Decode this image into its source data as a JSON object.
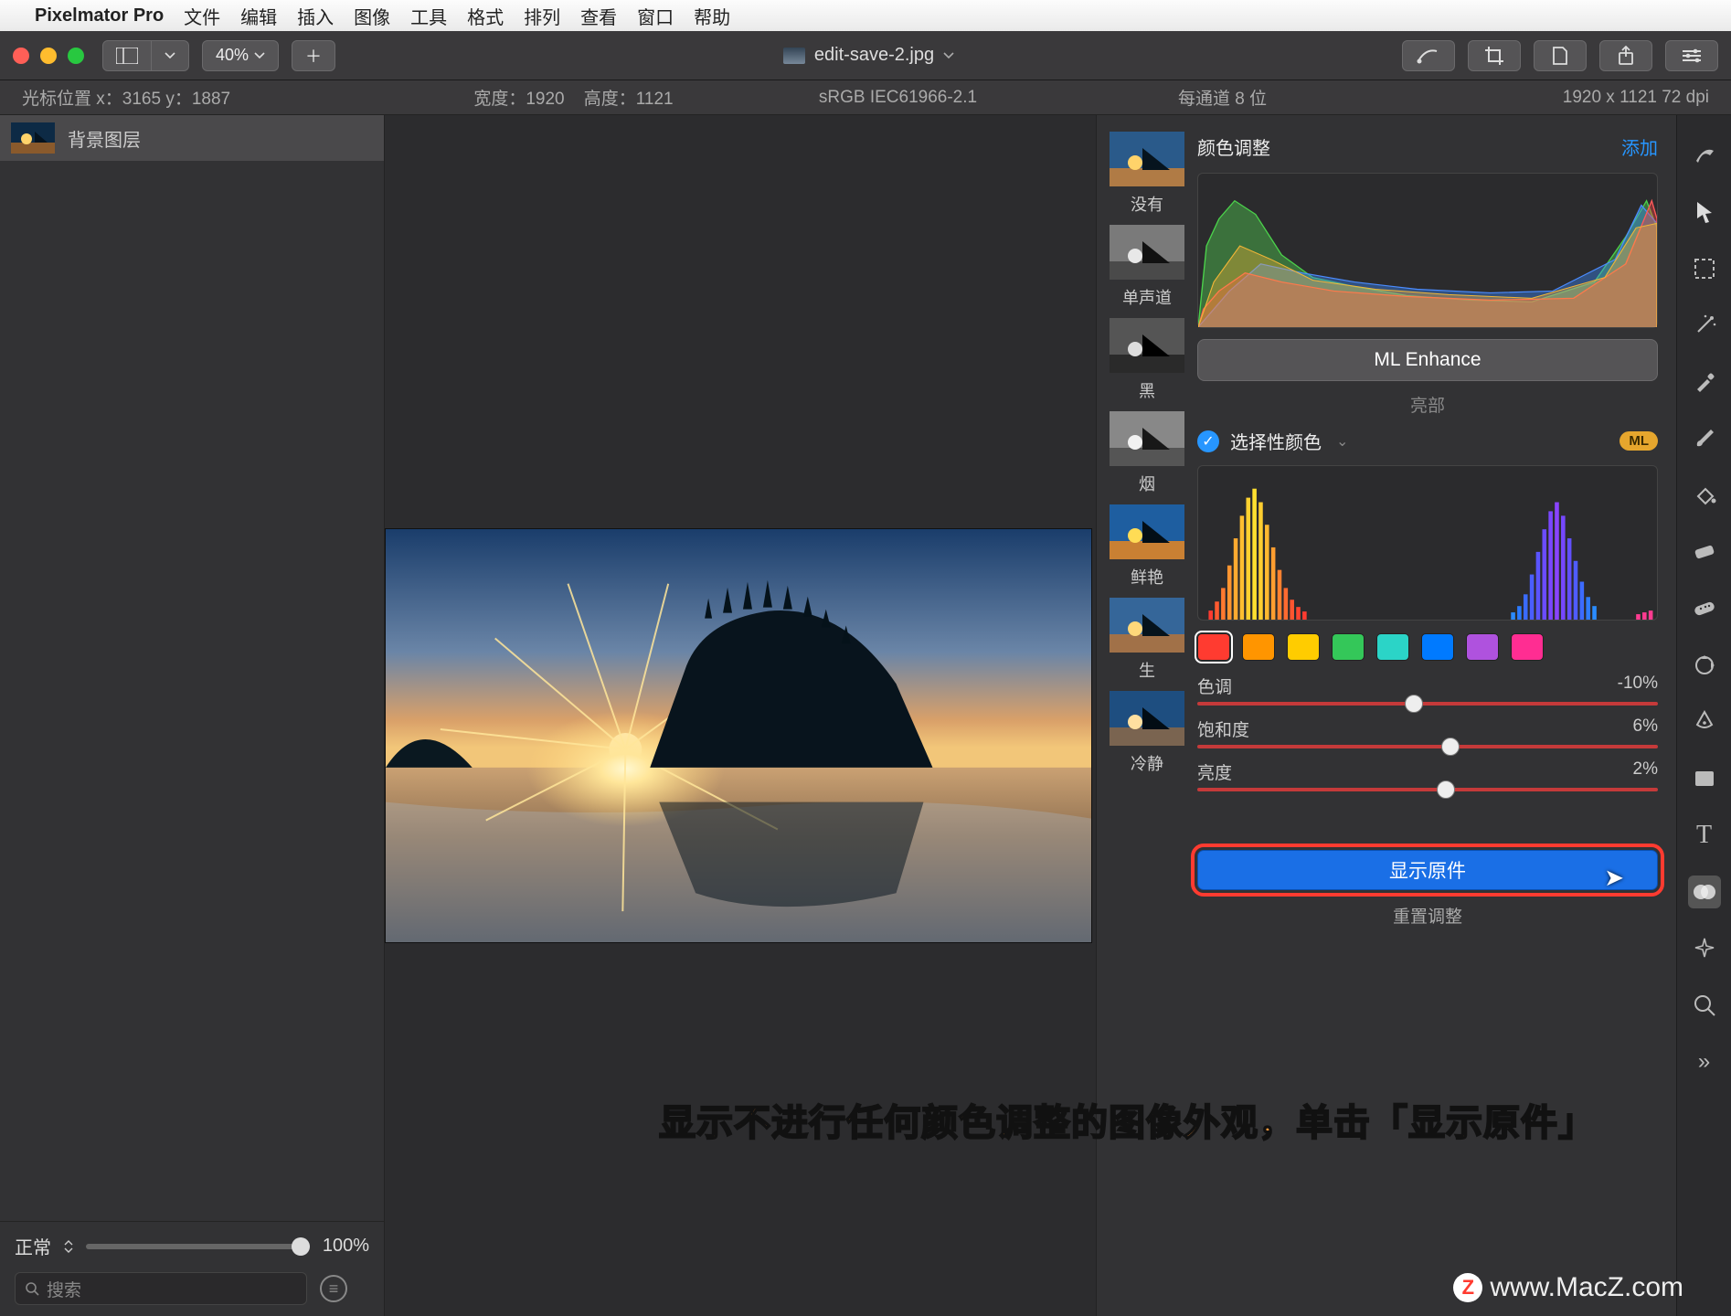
{
  "menubar": {
    "app": "Pixelmator Pro",
    "items": [
      "文件",
      "编辑",
      "插入",
      "图像",
      "工具",
      "格式",
      "排列",
      "查看",
      "窗口",
      "帮助"
    ]
  },
  "toolbar": {
    "zoom": "40%",
    "filename": "edit-save-2.jpg"
  },
  "infobar": {
    "cursor": "光标位置 x：3165    y：1887",
    "width": "宽度：1920",
    "height": "高度：1121",
    "profile": "sRGB IEC61966-2.1",
    "depth": "每通道 8 位",
    "dims": "1920 x 1121 72 dpi"
  },
  "layers": {
    "bg": "背景图层"
  },
  "left_bottom": {
    "blend": "正常",
    "opacity": "100%",
    "search_placeholder": "搜索"
  },
  "presets": [
    "没有",
    "单声道",
    "黑",
    "烟",
    "鲜艳",
    "生",
    "冷静"
  ],
  "inspector": {
    "title": "颜色调整",
    "add": "添加",
    "ml_enhance": "ML Enhance",
    "highlights": "亮部",
    "selective": "选择性颜色",
    "ml_pill": "ML",
    "hue": {
      "label": "色调",
      "value": "-10%"
    },
    "sat": {
      "label": "饱和度",
      "value": "6%"
    },
    "lum": {
      "label": "亮度",
      "value": "2%"
    },
    "show_original": "显示原件",
    "reset": "重置调整"
  },
  "swatches": [
    "#ff3b30",
    "#ff9500",
    "#ffcc00",
    "#34c759",
    "#2bd4c7",
    "#007aff",
    "#af52de",
    "#ff2d92"
  ],
  "annotation": "显示不进行任何颜色调整的图像外观，单击「显示原件」",
  "watermark": "www.MacZ.com",
  "chart_data": {
    "type": "histogram-rgb-overlay",
    "note": "visual RGB histogram — values are illustrative bin heights for recreation only",
    "bins": 32
  },
  "sliders": {
    "opacity_pct": 100,
    "hue_pct": 45,
    "sat_pct": 53,
    "lum_pct": 52
  }
}
